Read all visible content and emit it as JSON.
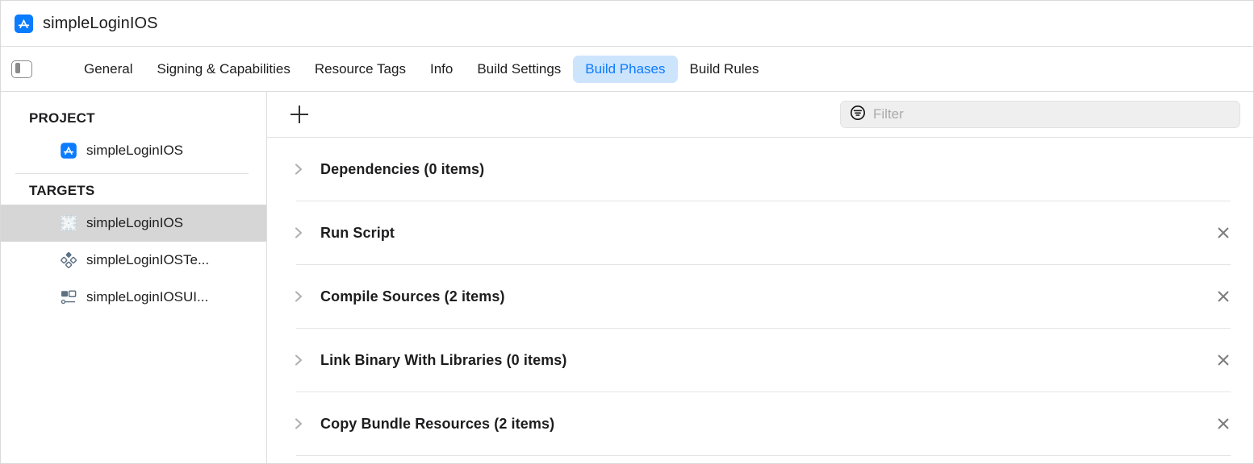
{
  "titlebar": {
    "icon": "appstore-icon",
    "title": "simpleLoginIOS"
  },
  "tabbar": {
    "toggle_icon": "sidebar-toggle-icon",
    "tabs": [
      {
        "label": "General",
        "selected": false
      },
      {
        "label": "Signing & Capabilities",
        "selected": false
      },
      {
        "label": "Resource Tags",
        "selected": false
      },
      {
        "label": "Info",
        "selected": false
      },
      {
        "label": "Build Settings",
        "selected": false
      },
      {
        "label": "Build Phases",
        "selected": true
      },
      {
        "label": "Build Rules",
        "selected": false
      }
    ],
    "selected_tab": "Build Phases",
    "selected_tab_bg": "#cde4fd",
    "selected_tab_color": "#0a7cff"
  },
  "sidebar": {
    "project_section": {
      "header": "PROJECT",
      "items": [
        {
          "label": "simpleLoginIOS",
          "icon": "appstore-icon",
          "selected": false
        }
      ]
    },
    "targets_section": {
      "header": "TARGETS",
      "items": [
        {
          "label": "simpleLoginIOS",
          "icon": "app-target-icon",
          "selected": true
        },
        {
          "label": "simpleLoginIOSTe...",
          "icon": "unit-test-target-icon",
          "selected": false
        },
        {
          "label": "simpleLoginIOSUI...",
          "icon": "ui-test-target-icon",
          "selected": false
        }
      ]
    },
    "selection_bg": "#d6d6d6"
  },
  "toolbar": {
    "add_icon": "plus-icon",
    "filter": {
      "icon": "filter-icon",
      "placeholder": "Filter",
      "value": ""
    }
  },
  "build_phases": [
    {
      "name": "Dependencies (0 items)",
      "expanded": false,
      "removable": false
    },
    {
      "name": "Run Script",
      "expanded": false,
      "removable": true
    },
    {
      "name": "Compile Sources (2 items)",
      "expanded": false,
      "removable": true
    },
    {
      "name": "Link Binary With Libraries (0 items)",
      "expanded": false,
      "removable": true
    },
    {
      "name": "Copy Bundle Resources (2 items)",
      "expanded": false,
      "removable": true
    }
  ]
}
